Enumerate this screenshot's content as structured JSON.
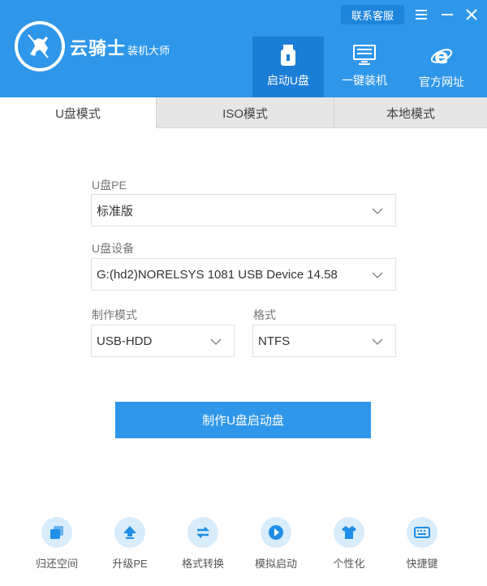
{
  "brand": {
    "name": "云骑士",
    "sub": "装机大师"
  },
  "topbar": {
    "service_label": "联系客服"
  },
  "nav": [
    {
      "label": "启动U盘",
      "icon": "usb-icon",
      "active": true
    },
    {
      "label": "一键装机",
      "icon": "monitor-icon",
      "active": false
    },
    {
      "label": "官方网址",
      "icon": "ie-browser-icon",
      "active": false
    }
  ],
  "modes": [
    {
      "label": "U盘模式",
      "active": true
    },
    {
      "label": "ISO模式",
      "active": false
    },
    {
      "label": "本地模式",
      "active": false
    }
  ],
  "form": {
    "pe_label": "U盘PE",
    "pe_value": "标准版",
    "device_label": "U盘设备",
    "device_value": "G:(hd2)NORELSYS 1081 USB Device 14.58",
    "mode_label": "制作模式",
    "mode_value": "USB-HDD",
    "format_label": "格式",
    "format_value": "NTFS"
  },
  "primary_button": "制作U盘启动盘",
  "tools": [
    {
      "label": "归还空间",
      "icon": "restore-space-icon"
    },
    {
      "label": "升级PE",
      "icon": "upgrade-icon"
    },
    {
      "label": "格式转换",
      "icon": "convert-icon"
    },
    {
      "label": "模拟启动",
      "icon": "simulate-boot-icon"
    },
    {
      "label": "个性化",
      "icon": "tshirt-icon"
    },
    {
      "label": "快捷键",
      "icon": "keyboard-icon"
    }
  ],
  "colors": {
    "accent": "#2f97ea",
    "accent_dark": "#1a7ed6",
    "tool_bg": "#d9ecfb"
  }
}
